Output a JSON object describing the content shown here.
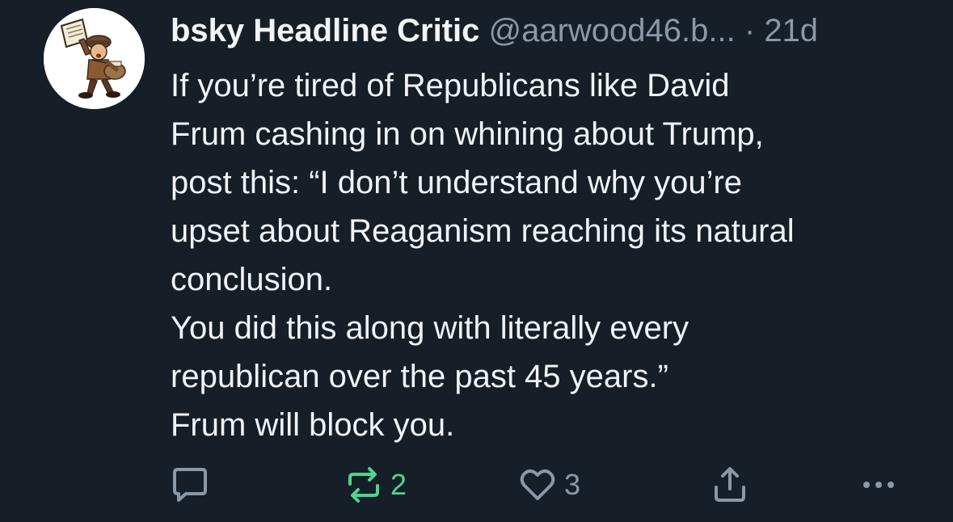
{
  "post": {
    "author": {
      "display_name": "bsky Headline Critic",
      "handle": "@aarwood46.b...",
      "separator": "·",
      "age": "21d",
      "avatar_icon": "newsboy-avatar"
    },
    "text_lines": [
      "If you’re tired of Republicans like David",
      "Frum cashing in on whining about Trump,",
      "post this: “I don’t understand why you’re",
      "upset about Reaganism reaching its natural",
      "conclusion.",
      "You did this along with literally every",
      "republican over the past 45 years.”",
      "Frum will block you."
    ],
    "actions": {
      "reply": {
        "icon": "reply-icon",
        "count": ""
      },
      "repost": {
        "icon": "repost-icon",
        "count": "2",
        "active": true,
        "color": "#4ed58f"
      },
      "like": {
        "icon": "heart-icon",
        "count": "3"
      },
      "share": {
        "icon": "share-icon"
      },
      "more": {
        "icon": "more-options-icon"
      }
    }
  },
  "colors": {
    "background": "#161e27",
    "text_primary": "#f1f3f5",
    "text_secondary": "#8b98a5",
    "repost_active": "#4ed58f"
  }
}
